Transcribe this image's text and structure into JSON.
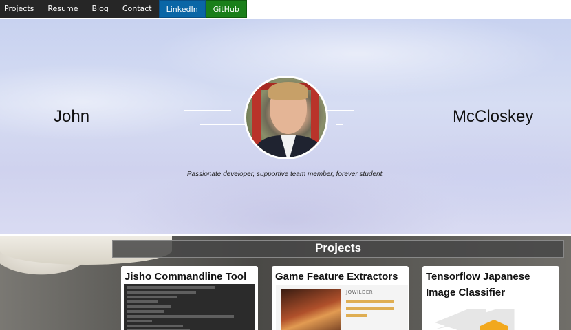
{
  "nav": {
    "items": [
      {
        "label": "Projects"
      },
      {
        "label": "Resume"
      },
      {
        "label": "Blog"
      },
      {
        "label": "Contact"
      },
      {
        "label": "LinkedIn"
      },
      {
        "label": "GitHub"
      }
    ]
  },
  "hero": {
    "first_name": "John",
    "last_name": "McCloskey",
    "tagline": "Passionate developer, supportive team member, forever student."
  },
  "projects": {
    "heading": "Projects",
    "cards": [
      {
        "title": "Jisho Commandline Tool"
      },
      {
        "title": "Game Feature Extractors",
        "brand": "JOWILDER"
      },
      {
        "title": "Tensorflow Japanese Image Classifier"
      }
    ]
  },
  "colors": {
    "nav_bg": "#262626",
    "linkedin": "#0a66a6",
    "github": "#1a7f1a",
    "hero_sky": "#d6ddf3",
    "projects_header": "#464646"
  }
}
